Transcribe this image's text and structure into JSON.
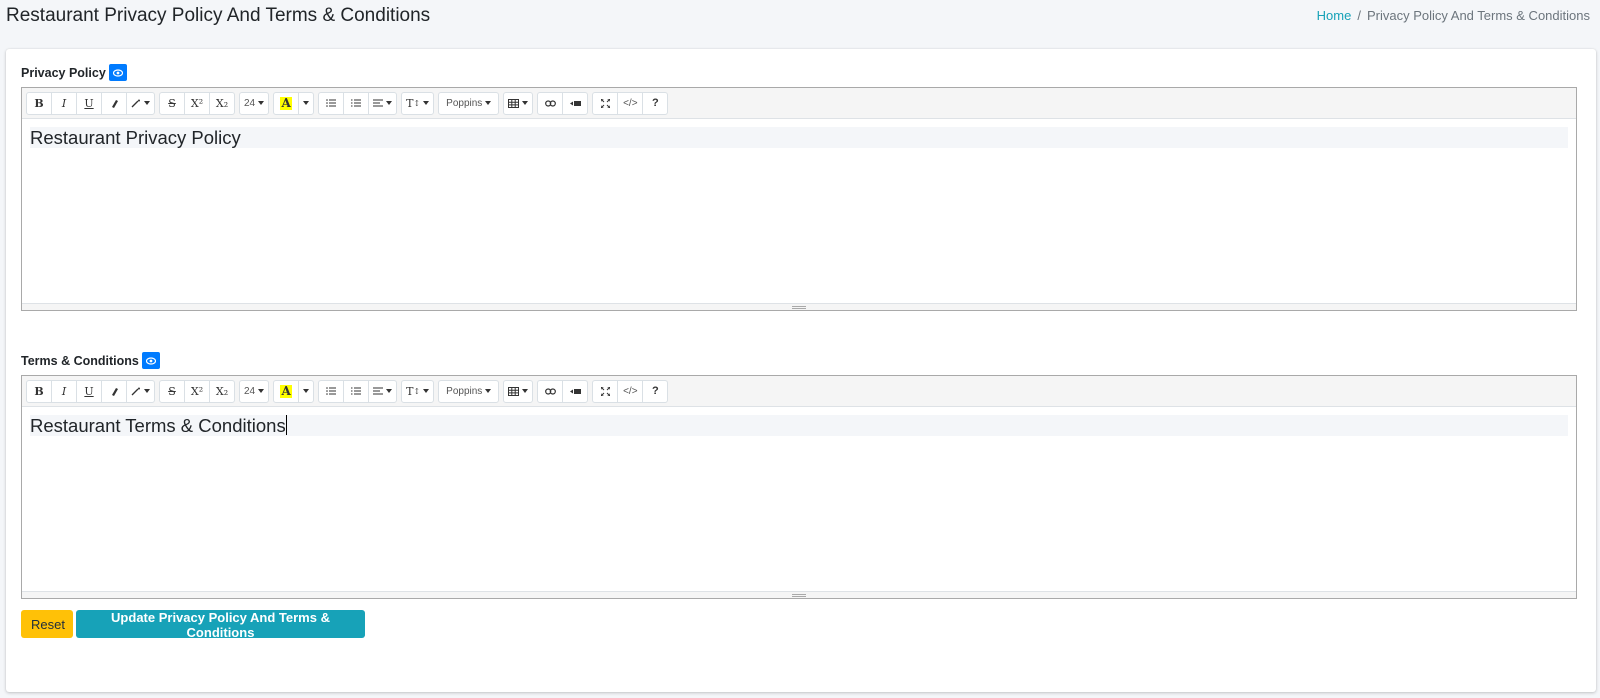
{
  "header": {
    "title": "Restaurant Privacy Policy And Terms & Conditions",
    "breadcrumb": {
      "home": "Home",
      "separator": "/",
      "current": "Privacy Policy And Terms & Conditions"
    }
  },
  "toolbar": {
    "bold": "B",
    "italic": "I",
    "underline": "U",
    "eraser": "⌫",
    "magic": "✨",
    "strike": "S",
    "superscript": "X²",
    "subscript": "X₂",
    "font_size": "24",
    "color_letter": "A",
    "font_family": "Poppins",
    "help": "?",
    "code": "</>"
  },
  "privacy": {
    "label": "Privacy Policy",
    "content": "Restaurant Privacy Policy"
  },
  "terms": {
    "label": "Terms & Conditions",
    "content": "Restaurant Terms & Conditions"
  },
  "actions": {
    "reset": "Reset",
    "update": "Update Privacy Policy And Terms & Conditions"
  },
  "colors": {
    "primary": "#007bff",
    "info": "#17a2b8",
    "warning": "#ffc107"
  }
}
